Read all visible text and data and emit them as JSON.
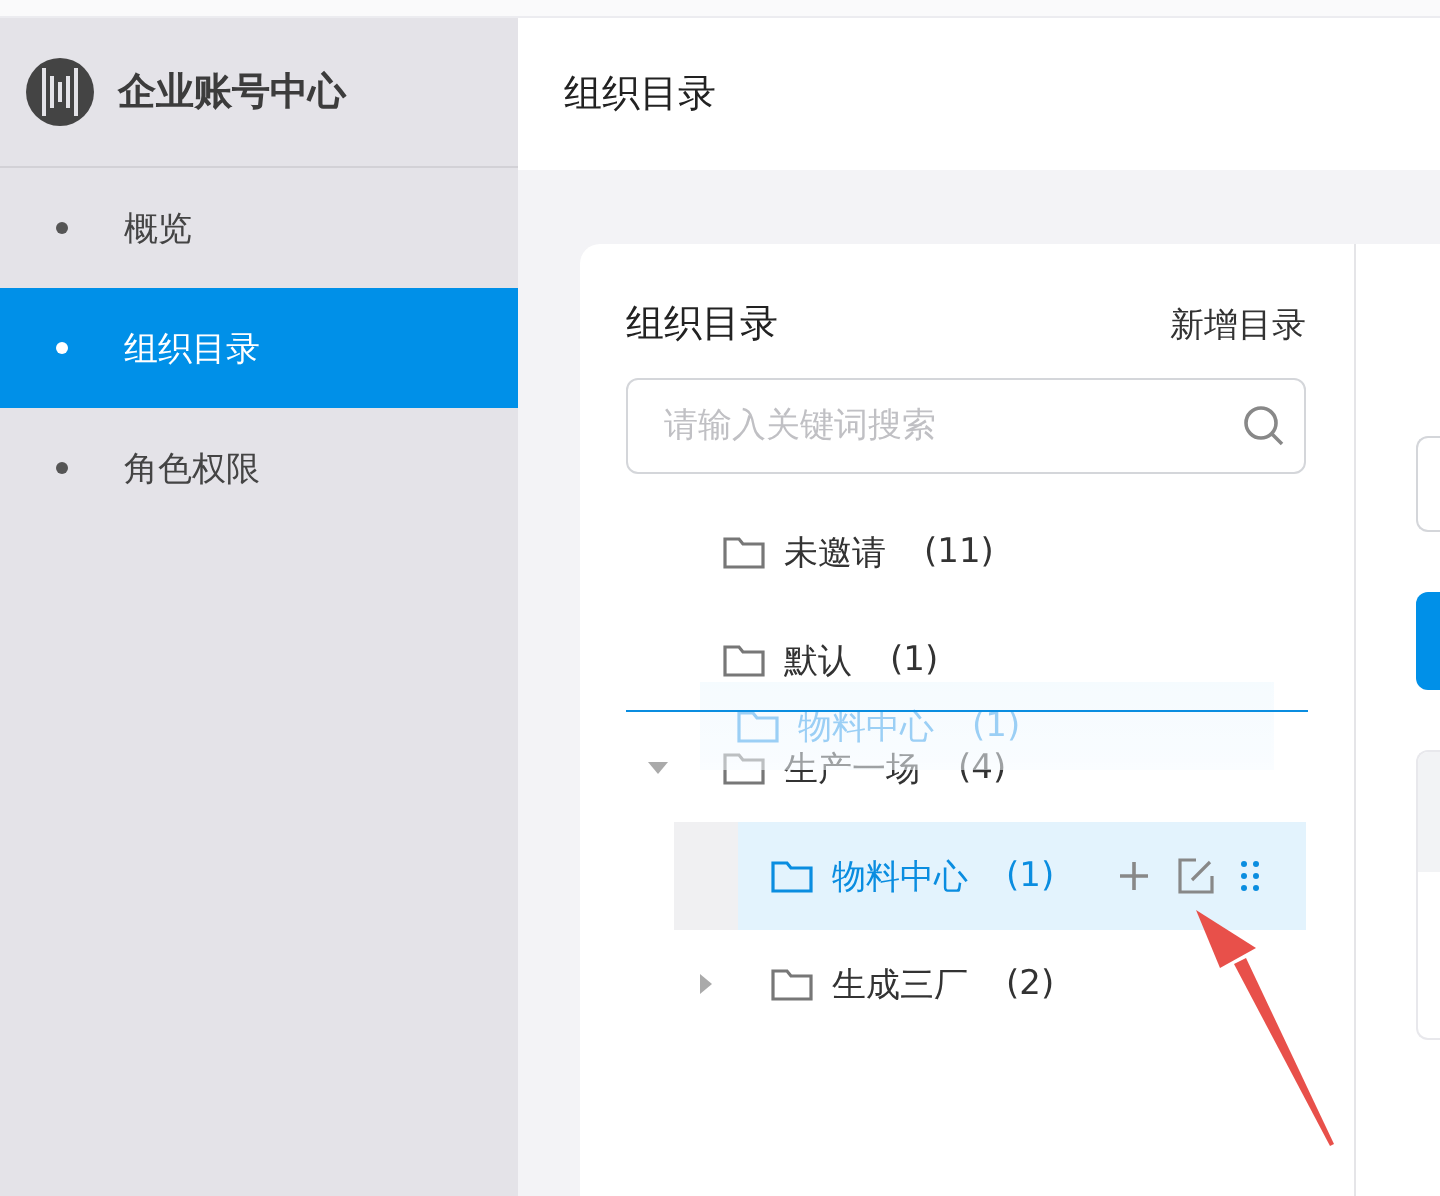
{
  "sidebar": {
    "brand": "企业账号中心",
    "items": [
      {
        "label": "概览",
        "selected": false
      },
      {
        "label": "组织目录",
        "selected": true
      },
      {
        "label": "角色权限",
        "selected": false
      }
    ]
  },
  "header": {
    "title": "组织目录"
  },
  "directory": {
    "title": "组织目录",
    "add_link": "新增目录",
    "search": {
      "placeholder": "请输入关键词搜索"
    },
    "tree": [
      {
        "label": "未邀请",
        "count": "(11)",
        "kind": "leaf",
        "selected": false
      },
      {
        "label": "默认",
        "count": "(1)",
        "kind": "leaf",
        "selected": false
      },
      {
        "label": "生产一场",
        "count": "(4)",
        "kind": "group",
        "expanded": true,
        "selected": false,
        "children": [
          {
            "label": "物料中心",
            "count": "(1)",
            "kind": "leaf",
            "selected": true
          },
          {
            "label": "生成三厂",
            "count": "(2)",
            "kind": "group",
            "expanded": false,
            "selected": false
          }
        ]
      }
    ],
    "drag_ghost": {
      "label": "物料中心",
      "count": "(1)"
    }
  }
}
